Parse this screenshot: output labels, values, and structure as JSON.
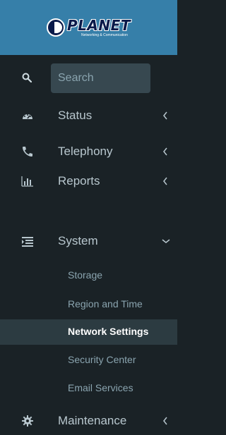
{
  "brand": {
    "name": "PLANET",
    "tagline": "Networking & Communication"
  },
  "search": {
    "placeholder": "Search"
  },
  "menu": [
    {
      "label": "Status",
      "icon": "dashboard-gauge-icon",
      "expanded": false
    },
    {
      "label": "Telephony",
      "icon": "phone-icon",
      "expanded": false
    },
    {
      "label": "Reports",
      "icon": "bar-chart-icon",
      "expanded": false
    },
    {
      "label": "System",
      "icon": "list-icon",
      "expanded": true
    },
    {
      "label": "Maintenance",
      "icon": "gear-icon",
      "expanded": false
    }
  ],
  "system_submenu": [
    {
      "label": "Storage",
      "active": false
    },
    {
      "label": "Region and Time",
      "active": false
    },
    {
      "label": "Network Settings",
      "active": true
    },
    {
      "label": "Security Center",
      "active": false
    },
    {
      "label": "Email Services",
      "active": false
    }
  ],
  "colors": {
    "sidebar_bg": "#1a2226",
    "logo_bg": "#367fa9",
    "text": "#b8c7ce",
    "active_bg": "#2c3b41",
    "active_text": "#ffffff"
  }
}
